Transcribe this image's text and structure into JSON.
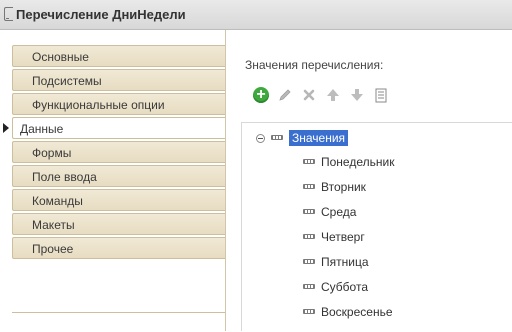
{
  "window": {
    "title": "Перечисление ДниНедели"
  },
  "sidebar": {
    "items": [
      {
        "label": "Основные",
        "active": false
      },
      {
        "label": "Подсистемы",
        "active": false
      },
      {
        "label": "Функциональные опции",
        "active": false
      },
      {
        "label": "Данные",
        "active": true
      },
      {
        "label": "Формы",
        "active": false
      },
      {
        "label": "Поле ввода",
        "active": false
      },
      {
        "label": "Команды",
        "active": false
      },
      {
        "label": "Макеты",
        "active": false
      },
      {
        "label": "Прочее",
        "active": false
      }
    ]
  },
  "panel": {
    "label": "Значения перечисления:",
    "toolbar": [
      "add-icon",
      "edit-icon",
      "delete-icon",
      "move-up-icon",
      "move-down-icon",
      "list-icon"
    ]
  },
  "tree": {
    "root": {
      "label": "Значения",
      "expanded": true,
      "selected": true
    },
    "children": [
      "Понедельник",
      "Вторник",
      "Среда",
      "Четверг",
      "Пятница",
      "Суббота",
      "Воскресенье"
    ]
  },
  "colors": {
    "selection": "#3a6fd0",
    "sidebar_tab": "#ede3cc",
    "add_green": "#3fa93f",
    "icon_gray": "#b7b7b7"
  }
}
